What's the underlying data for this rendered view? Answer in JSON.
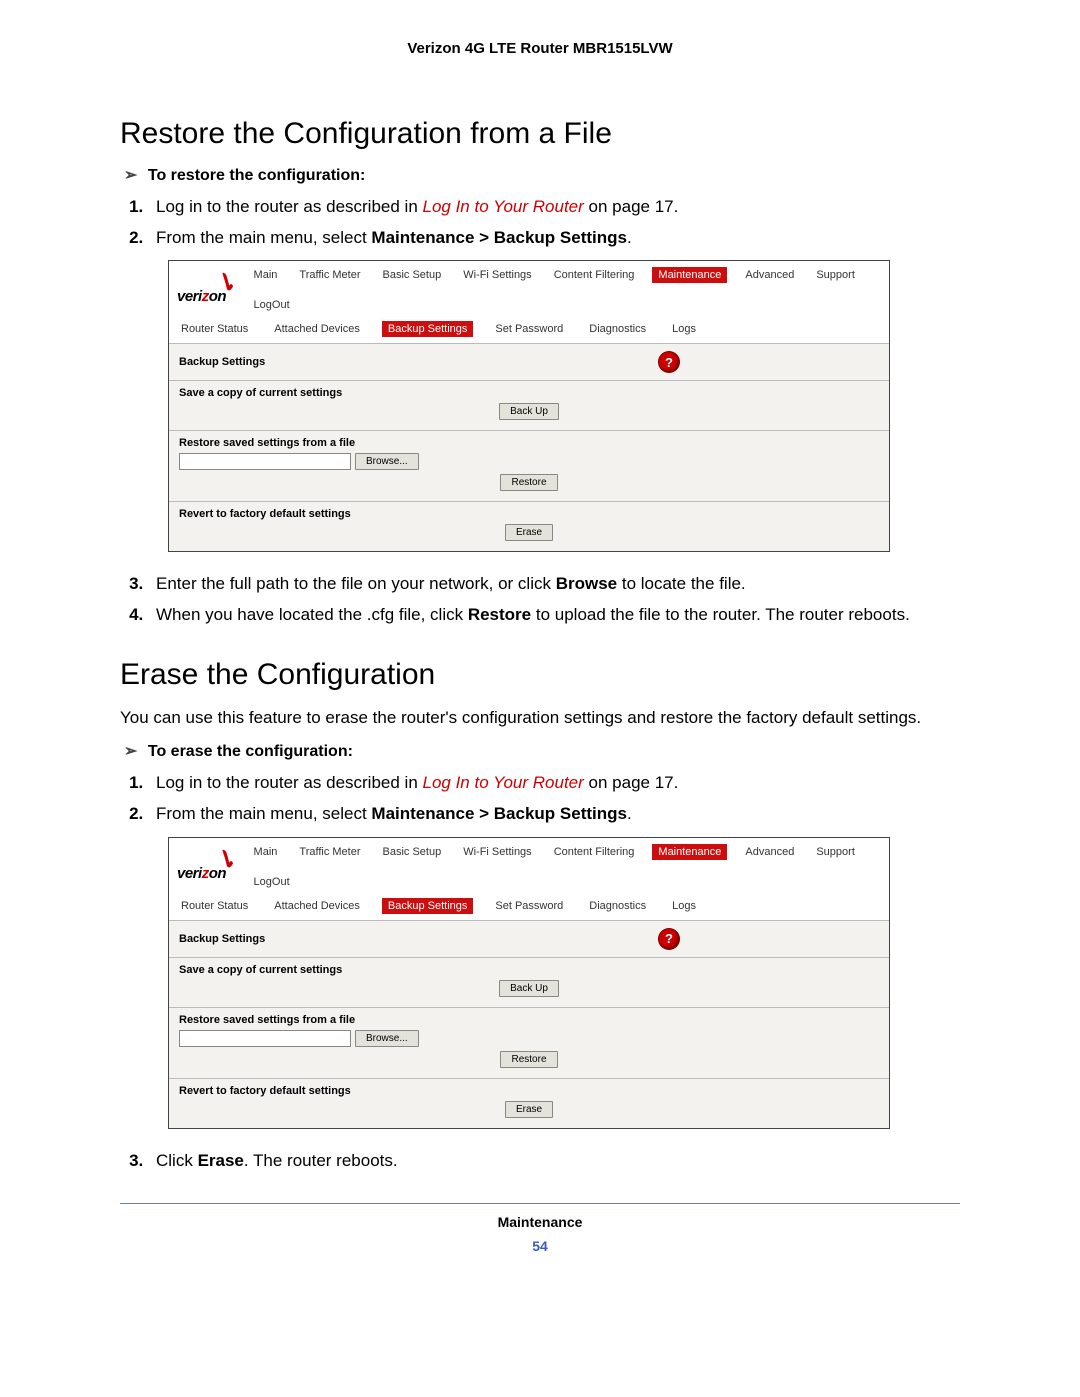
{
  "header": {
    "product": "Verizon 4G LTE Router MBR1515LVW"
  },
  "section1": {
    "title": "Restore the Configuration from a File",
    "proc_header": "To restore the configuration:",
    "steps": {
      "s1_pre": "Log in to the router as described in ",
      "s1_link": "Log In to Your Router",
      "s1_post": " on page 17.",
      "s2_pre": "From the main menu, select ",
      "s2_bold": "Maintenance > Backup Settings",
      "s2_post": ".",
      "s3_pre": "Enter the full path to the file on your network, or click ",
      "s3_bold": "Browse",
      "s3_post": " to locate the file.",
      "s4_pre": "When you have located the .cfg file, click ",
      "s4_bold": "Restore",
      "s4_post": " to upload the file to the router. The router reboots."
    }
  },
  "section2": {
    "title": "Erase the Configuration",
    "intro": "You can use this feature to erase the router's configuration settings and restore the factory default settings.",
    "proc_header": "To erase the configuration:",
    "steps": {
      "s1_pre": "Log in to the router as described in ",
      "s1_link": "Log In to Your Router",
      "s1_post": " on page 17.",
      "s2_pre": "From the main menu, select ",
      "s2_bold": "Maintenance > Backup Settings",
      "s2_post": ".",
      "s3_pre": "Click ",
      "s3_bold": "Erase",
      "s3_post": ". The router reboots."
    }
  },
  "router_ui": {
    "logo_word_a": "veri",
    "logo_word_b": "z",
    "logo_word_c": "on",
    "nav": {
      "main": "Main",
      "traffic": "Traffic Meter",
      "basic": "Basic Setup",
      "wifi": "Wi-Fi Settings",
      "content": "Content Filtering",
      "maint": "Maintenance",
      "adv": "Advanced",
      "support": "Support",
      "logout": "LogOut"
    },
    "subnav": {
      "status": "Router Status",
      "attached": "Attached Devices",
      "backup": "Backup Settings",
      "setpw": "Set Password",
      "diag": "Diagnostics",
      "logs": "Logs"
    },
    "panel": {
      "title": "Backup Settings",
      "help": "?",
      "save_label": "Save a copy of current settings",
      "backup_btn": "Back Up",
      "restore_label": "Restore saved settings from a file",
      "browse_btn": "Browse...",
      "restore_btn": "Restore",
      "revert_label": "Revert to factory default settings",
      "erase_btn": "Erase"
    }
  },
  "footer": {
    "chapter": "Maintenance",
    "page": "54"
  }
}
